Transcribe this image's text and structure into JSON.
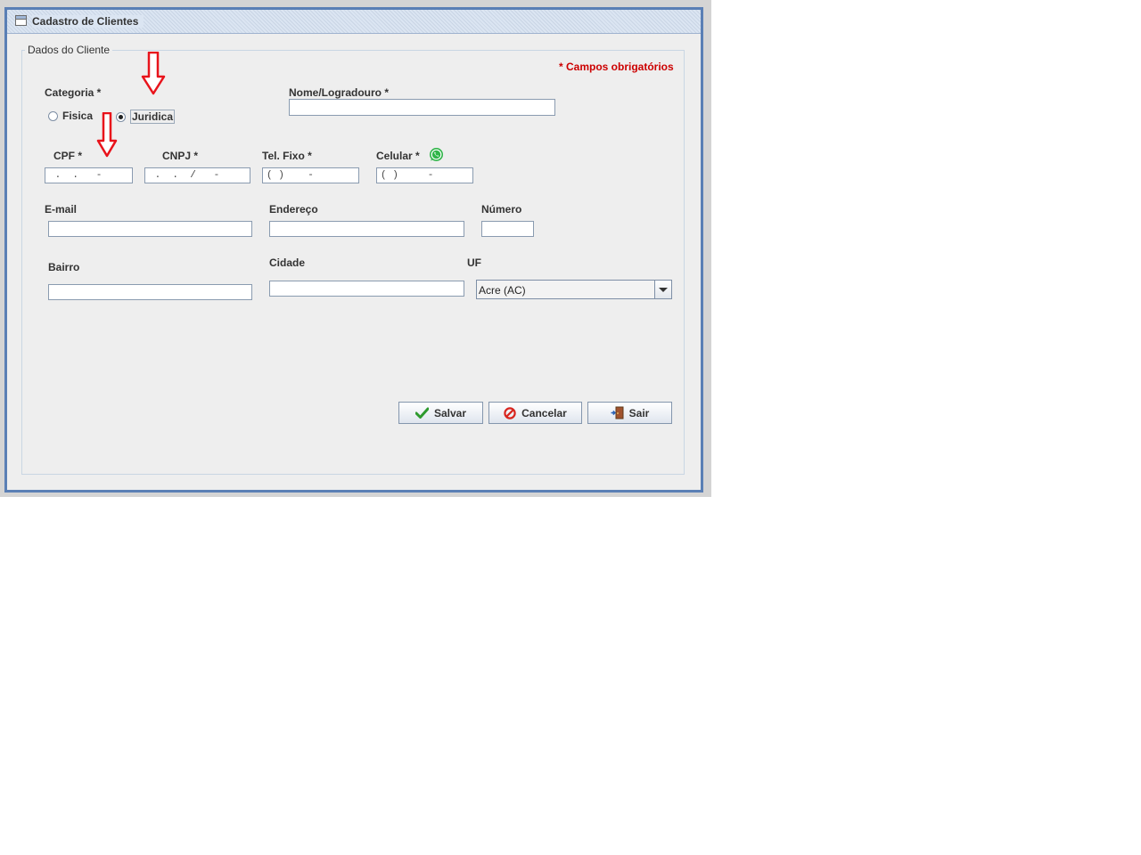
{
  "window": {
    "title": "Cadastro de Clientes"
  },
  "group": {
    "legend": "Dados do Cliente"
  },
  "required_note": "* Campos obrigatórios",
  "categoria": {
    "label": "Categoria *",
    "options": [
      {
        "label": "Fisica",
        "selected": false
      },
      {
        "label": "Juridica",
        "selected": true
      }
    ]
  },
  "fields": {
    "nome": {
      "label": "Nome/Logradouro *",
      "value": ""
    },
    "cpf": {
      "label": "CPF *",
      "mask": " .  .   -"
    },
    "cnpj": {
      "label": "CNPJ *",
      "mask": " .  .  /   -"
    },
    "tel_fixo": {
      "label": "Tel. Fixo *",
      "mask": "( )    -"
    },
    "celular": {
      "label": "Celular *",
      "mask": "( )     -",
      "icon": "whatsapp-icon"
    },
    "email": {
      "label": "E-mail",
      "value": ""
    },
    "endereco": {
      "label": "Endereço",
      "value": ""
    },
    "numero": {
      "label": "Número",
      "value": ""
    },
    "bairro": {
      "label": "Bairro",
      "value": ""
    },
    "cidade": {
      "label": "Cidade",
      "value": ""
    },
    "uf": {
      "label": "UF",
      "selected": "Acre (AC)"
    }
  },
  "buttons": {
    "salvar": {
      "label": "Salvar",
      "icon": "checkmark-icon"
    },
    "cancelar": {
      "label": "Cancelar",
      "icon": "cancel-icon"
    },
    "sair": {
      "label": "Sair",
      "icon": "exit-door-icon"
    }
  },
  "colors": {
    "required": "#cc0000",
    "border": "#5a7fb5",
    "annotation_arrow": "#e8131b",
    "whatsapp": "#2fb548"
  },
  "annotations": [
    "arrow-down-icon",
    "arrow-down-icon"
  ]
}
